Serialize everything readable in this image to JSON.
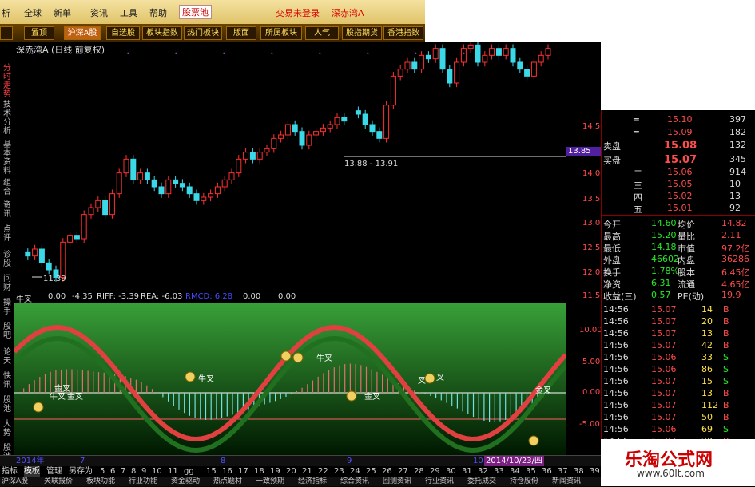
{
  "menu": {
    "items": [
      "析",
      "全球",
      "新单",
      "资讯",
      "工具",
      "帮助",
      "股票池",
      "交易未登录",
      "深赤湾A"
    ]
  },
  "toolbar": {
    "items": [
      "",
      "置顶",
      "沪深A股",
      "自选股",
      "板块指数",
      "热门板块",
      "版面",
      "所属板块",
      "人气",
      "股指期货",
      "香港指数"
    ]
  },
  "side_nav": [
    "分时走势",
    "技术分析",
    "基本资料",
    "组合",
    "资讯",
    "点评",
    "诊股",
    "问财",
    "操手",
    "股吧",
    "论天",
    "快讯",
    "股池",
    "大势",
    "股池"
  ],
  "chart": {
    "title": "深赤湾A (日线 前复权)",
    "price_ticks": [
      "14.50",
      "14.00",
      "13.50",
      "13.00",
      "12.50",
      "12.00",
      "11.50"
    ],
    "current_price_tag": "13.85",
    "crosshair_label": "13.88 - 13.91",
    "low_label": "11.39",
    "months": [
      "2014年",
      "7",
      "8",
      "9",
      "10",
      "11"
    ],
    "date_tag": "2014/10/23/四",
    "period": "日线"
  },
  "macd": {
    "label_bar": {
      "name": "牛叉",
      "v1": "0.00",
      "v2": "-4.35",
      "riff": "RIFF: -3.39",
      "rea": "REA: -6.03",
      "rmacd": "RMCD: 6.28",
      "v3": "0.00",
      "v4": "0.00"
    },
    "y_ticks": [
      "10.00",
      "5.00",
      "0.00",
      "-5.00"
    ],
    "annotations": [
      "牛叉",
      "金叉",
      "金叉",
      "牛叉",
      "牛叉",
      "金叉",
      "叉",
      "叉",
      "金叉"
    ]
  },
  "quote": {
    "sell": [
      {
        "label": "",
        "price": "15.10",
        "vol": "397"
      },
      {
        "label": "",
        "price": "15.09",
        "vol": "182"
      }
    ],
    "sell_label": "卖盘",
    "sell_price": "15.08",
    "sell_vol": "132",
    "buy_label": "买盘",
    "buy_price": "15.07",
    "buy_vol": "345",
    "buy": [
      {
        "label": "二",
        "price": "15.06",
        "vol": "914"
      },
      {
        "label": "三",
        "price": "15.05",
        "vol": "10"
      },
      {
        "label": "四",
        "price": "15.02",
        "vol": "13"
      },
      {
        "label": "五",
        "price": "15.01",
        "vol": "92"
      }
    ],
    "stats": [
      {
        "k1": "今开",
        "v1": "14.60",
        "k2": "均价",
        "v2": "14.82"
      },
      {
        "k1": "最高",
        "v1": "15.20",
        "k2": "量比",
        "v2": "2.11"
      },
      {
        "k1": "最低",
        "v1": "14.18",
        "k2": "市值",
        "v2": "97.2亿"
      },
      {
        "k1": "外盘",
        "v1": "46602",
        "k2": "内盘",
        "v2": "36286"
      },
      {
        "k1": "换手",
        "v1": "1.78%",
        "k2": "股本",
        "v2": "6.45亿"
      },
      {
        "k1": "净资",
        "v1": "6.31",
        "k2": "流通",
        "v2": "4.65亿"
      },
      {
        "k1": "收益(三)",
        "v1": "0.57",
        "k2": "PE(动)",
        "v2": "19.9"
      }
    ],
    "ticks": [
      {
        "t": "14:56",
        "p": "15.07",
        "v": "14",
        "d": "B"
      },
      {
        "t": "14:56",
        "p": "15.07",
        "v": "20",
        "d": "B"
      },
      {
        "t": "14:56",
        "p": "15.07",
        "v": "13",
        "d": "B"
      },
      {
        "t": "14:56",
        "p": "15.07",
        "v": "42",
        "d": "B"
      },
      {
        "t": "14:56",
        "p": "15.06",
        "v": "33",
        "d": "S"
      },
      {
        "t": "14:56",
        "p": "15.06",
        "v": "86",
        "d": "S"
      },
      {
        "t": "14:56",
        "p": "15.07",
        "v": "15",
        "d": "S"
      },
      {
        "t": "14:56",
        "p": "15.07",
        "v": "13",
        "d": "B"
      },
      {
        "t": "14:56",
        "p": "15.07",
        "v": "112",
        "d": "B"
      },
      {
        "t": "14:56",
        "p": "15.07",
        "v": "50",
        "d": "B"
      },
      {
        "t": "14:56",
        "p": "15.06",
        "v": "69",
        "d": "S"
      },
      {
        "t": "14:56",
        "p": "15.07",
        "v": "20",
        "d": "B"
      }
    ]
  },
  "bottom": {
    "row1": [
      "指标",
      "模板",
      "管理",
      "另存为",
      "5",
      "6",
      "7",
      "8",
      "9",
      "10",
      "11",
      "gg",
      "15",
      "16",
      "17",
      "18",
      "19",
      "20",
      "21",
      "22",
      "23",
      "24",
      "25",
      "26",
      "27",
      "28",
      "29",
      "30",
      "31",
      "32",
      "33",
      "34",
      "35",
      "36",
      "37",
      "38",
      "39",
      "40"
    ],
    "row2": [
      "沪深A股",
      "关联报价",
      "板块功能",
      "行业功能",
      "资金驱动",
      "热点题材",
      "一致预期",
      "经济指标",
      "综合资讯",
      "回测资讯",
      "行业资讯",
      "委托成交",
      "持仓股份",
      "新闻资讯"
    ]
  },
  "watermark": {
    "title": "乐淘公式网",
    "url": "www.60lt.com"
  },
  "colors": {
    "up": "#ff4c4c",
    "down": "#27e927",
    "macd_bg": "#2a8a2a",
    "accent": "#ffe14a"
  }
}
